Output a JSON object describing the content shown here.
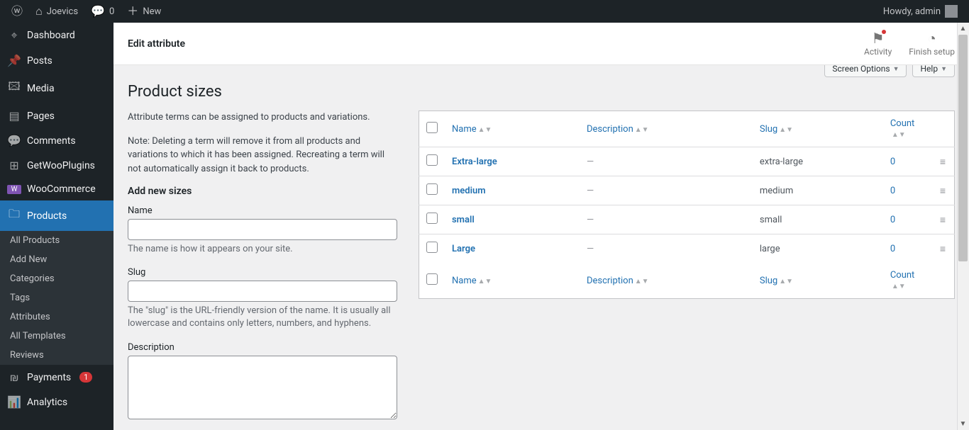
{
  "adminbar": {
    "site_name": "Joevics",
    "comments_count": "0",
    "new_label": "New",
    "howdy": "Howdy, admin"
  },
  "sidebar": {
    "items": [
      {
        "icon": "◉",
        "label": "Dashboard"
      },
      {
        "icon": "✎",
        "label": "Posts"
      },
      {
        "icon": "🖾",
        "label": "Media"
      },
      {
        "icon": "▤",
        "label": "Pages"
      },
      {
        "icon": "💬",
        "label": "Comments"
      },
      {
        "icon": "⊞",
        "label": "GetWooPlugins"
      },
      {
        "icon": "W",
        "label": "WooCommerce"
      },
      {
        "icon": "🗀",
        "label": "Products"
      },
      {
        "icon": "$",
        "label": "Payments",
        "badge": "1"
      },
      {
        "icon": "📊",
        "label": "Analytics"
      }
    ],
    "submenu": [
      {
        "label": "All Products"
      },
      {
        "label": "Add New"
      },
      {
        "label": "Categories"
      },
      {
        "label": "Tags"
      },
      {
        "label": "Attributes"
      },
      {
        "label": "All Templates"
      },
      {
        "label": "Reviews"
      }
    ]
  },
  "header": {
    "title": "Edit attribute",
    "activity": "Activity",
    "finish_setup": "Finish setup"
  },
  "tabs": {
    "screen_options": "Screen Options",
    "help": "Help"
  },
  "page": {
    "title": "Product sizes",
    "intro": "Attribute terms can be assigned to products and variations.",
    "note": "Note: Deleting a term will remove it from all products and variations to which it has been assigned. Recreating a term will not automatically assign it back to products."
  },
  "form": {
    "heading": "Add new sizes",
    "name_label": "Name",
    "name_hint": "The name is how it appears on your site.",
    "slug_label": "Slug",
    "slug_hint": "The \"slug\" is the URL-friendly version of the name. It is usually all lowercase and contains only letters, numbers, and hyphens.",
    "desc_label": "Description"
  },
  "table": {
    "cols": {
      "name": "Name",
      "description": "Description",
      "slug": "Slug",
      "count": "Count"
    },
    "rows": [
      {
        "name": "Extra-large",
        "description": "—",
        "slug": "extra-large",
        "count": "0"
      },
      {
        "name": "medium",
        "description": "—",
        "slug": "medium",
        "count": "0"
      },
      {
        "name": "small",
        "description": "—",
        "slug": "small",
        "count": "0"
      },
      {
        "name": "Large",
        "description": "—",
        "slug": "large",
        "count": "0"
      }
    ]
  }
}
